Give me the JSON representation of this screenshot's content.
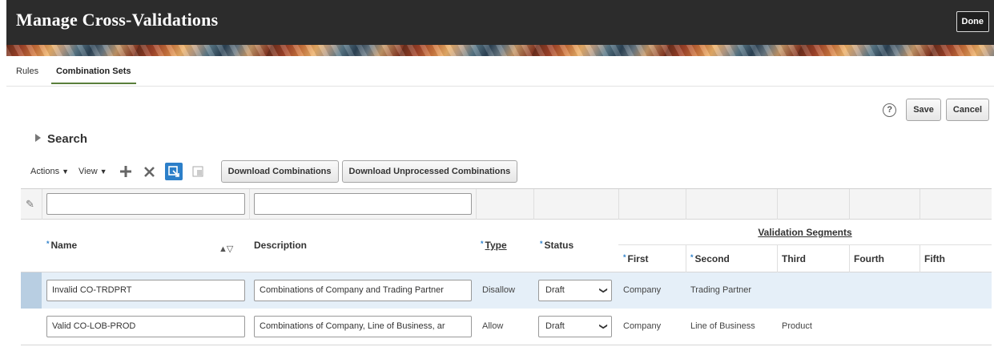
{
  "header": {
    "title": "Manage Cross-Validations",
    "done_label": "Done"
  },
  "tabs": [
    {
      "label": "Rules"
    },
    {
      "label": "Combination Sets"
    }
  ],
  "page_actions": {
    "help": "?",
    "save_label": "Save",
    "cancel_label": "Cancel"
  },
  "search": {
    "label": "Search"
  },
  "toolbar": {
    "actions_label": "Actions",
    "view_label": "View",
    "download_combinations": "Download Combinations",
    "download_unprocessed": "Download Unprocessed Combinations"
  },
  "table": {
    "headers": {
      "name": "Name",
      "description": "Description",
      "type": "Type",
      "status": "Status",
      "validation_segments": "Validation Segments",
      "first": "First",
      "second": "Second",
      "third": "Third",
      "fourth": "Fourth",
      "fifth": "Fifth"
    },
    "rows": [
      {
        "name": "Invalid CO-TRDPRT",
        "description": "Combinations of Company and Trading Partner",
        "type": "Disallow",
        "status": "Draft",
        "first": "Company",
        "second": "Trading Partner",
        "third": "",
        "fourth": "",
        "fifth": ""
      },
      {
        "name": "Valid CO-LOB-PROD",
        "description": "Combinations of Company, Line of Business, ar",
        "type": "Allow",
        "status": "Draft",
        "first": "Company",
        "second": "Line of Business",
        "third": "Product",
        "fourth": "",
        "fifth": ""
      }
    ]
  }
}
